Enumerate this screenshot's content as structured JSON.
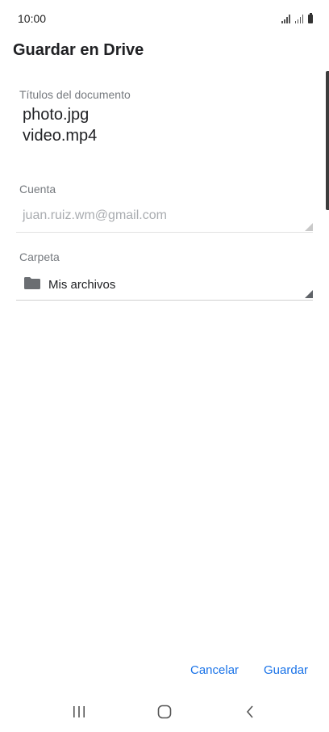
{
  "status_bar": {
    "time": "10:00",
    "icons": [
      "signal-icon",
      "signal-icon",
      "battery-icon"
    ]
  },
  "dialog": {
    "title": "Guardar en Drive",
    "document_titles_label": "Títulos del documento",
    "document_titles": [
      "photo.jpg",
      "video.mp4"
    ],
    "account_label": "Cuenta",
    "account_value": "juan.ruiz.wm@gmail.com",
    "folder_label": "Carpeta",
    "folder_value": "Mis archivos",
    "folder_icon": "folder-icon",
    "cancel_label": "Cancelar",
    "save_label": "Guardar"
  },
  "colors": {
    "accent": "#1a73e8",
    "text_primary": "#202124",
    "text_secondary": "#75797e",
    "text_disabled": "#a9acb0"
  },
  "nav_bar": {
    "icons": [
      "recents-icon",
      "home-icon",
      "back-icon"
    ]
  }
}
